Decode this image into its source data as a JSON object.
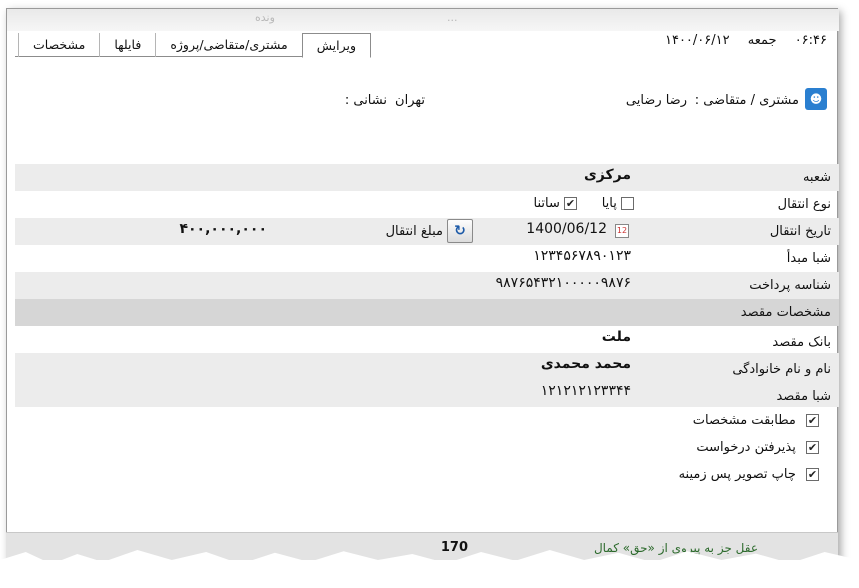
{
  "ghost_header": {
    "left_text": "ونده",
    "right_text": "..."
  },
  "tabs": [
    {
      "label": "ویرایش",
      "active": true
    },
    {
      "label": "مشتری/متقاضی/پروژه",
      "active": false
    },
    {
      "label": "فایلها",
      "active": false
    },
    {
      "label": "مشخصات",
      "active": false
    }
  ],
  "clock": {
    "time": "۰۶:۴۶",
    "weekday": "جمعه",
    "date": "۱۴۰۰/۰۶/۱۲"
  },
  "customer": {
    "label": "مشتری / متقاضی :",
    "name": "رضا رضایی",
    "icon": "customer-group-icon"
  },
  "address": {
    "label": "نشانی :",
    "value": "تهران"
  },
  "form": {
    "branch": {
      "label": "شعبه",
      "value": "مرکزی"
    },
    "transfer_type": {
      "label": "نوع انتقال",
      "options": [
        {
          "label": "پایا",
          "checked": false
        },
        {
          "label": "ساتنا",
          "checked": true
        }
      ]
    },
    "transfer_date": {
      "label": "تاریخ انتقال",
      "value": "1400/06/12",
      "icon": "calendar-icon"
    },
    "transfer_amount": {
      "label": "مبلغ انتقال",
      "value": "۴۰۰,۰۰۰,۰۰۰",
      "button_icon": "refresh-icon"
    },
    "source_sheba": {
      "label": "شبا مبدأ",
      "value": "۱۲۳۴۵۶۷۸۹۰۱۲۳"
    },
    "payment_id": {
      "label": "شناسه پرداخت",
      "value": "۹۸۷۶۵۴۳۲۱۰۰۰۰۰۹۸۷۶"
    },
    "destination_section": "مشخصات مقصد",
    "dest_bank": {
      "label": "بانک مقصد",
      "value": "ملت"
    },
    "dest_name": {
      "label": "نام و نام خانوادگی",
      "value": "محمد محمدی"
    },
    "dest_sheba": {
      "label": "شبا مقصد",
      "value": "۱۲۱۲۱۲۱۲۳۳۴۴"
    },
    "checks": [
      {
        "label": "مطابقت مشخصات",
        "checked": true
      },
      {
        "label": "پذیرفتن درخواست",
        "checked": true
      },
      {
        "label": "چاپ تصویر پس زمینه",
        "checked": true
      }
    ]
  },
  "statusbar": {
    "left_text": "170",
    "right_text": "عقل جز به پیروی از «حق» کمال"
  }
}
